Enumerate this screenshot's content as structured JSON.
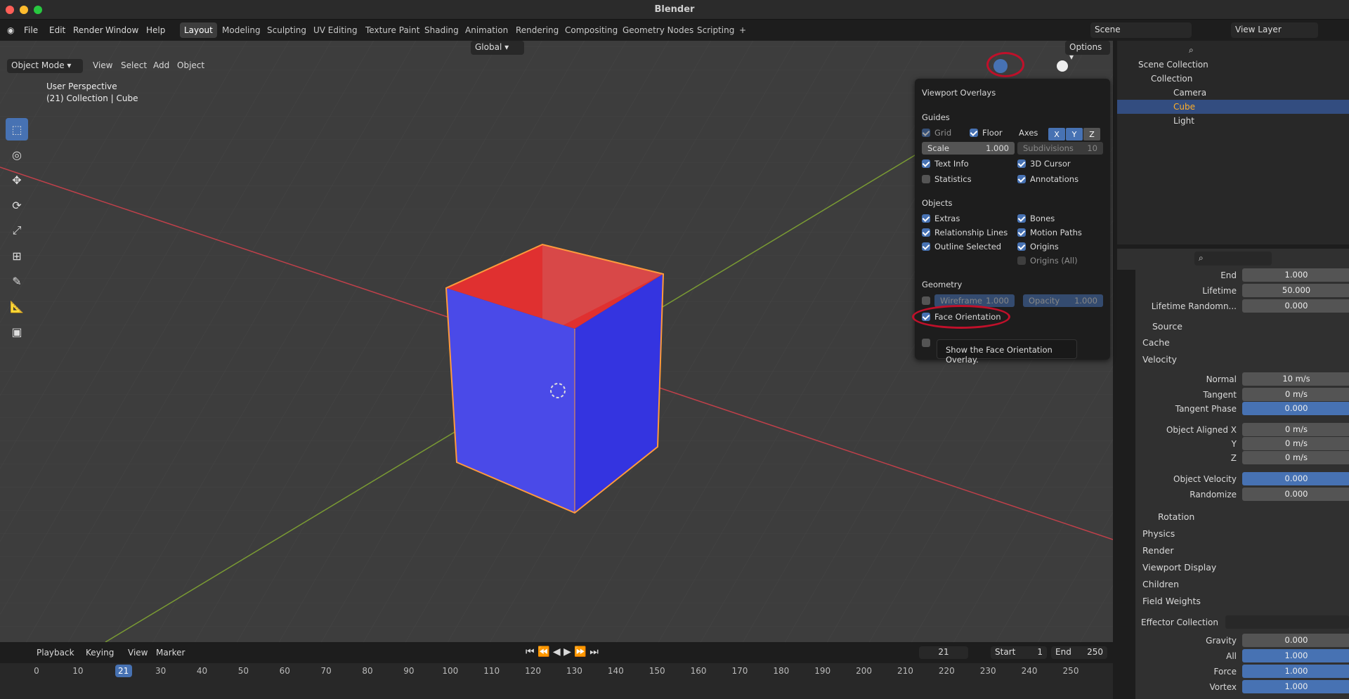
{
  "window": {
    "title": "Blender"
  },
  "menu": [
    "File",
    "Edit",
    "Render",
    "Window",
    "Help"
  ],
  "workspaces": [
    "Layout",
    "Modeling",
    "Sculpting",
    "UV Editing",
    "Texture Paint",
    "Shading",
    "Animation",
    "Rendering",
    "Compositing",
    "Geometry Nodes",
    "Scripting"
  ],
  "active_workspace": "Layout",
  "scene": {
    "scene_name": "Scene",
    "view_layer": "View Layer"
  },
  "viewport": {
    "mode": "Object Mode",
    "menus": [
      "View",
      "Select",
      "Add",
      "Object"
    ],
    "orientation": "Global",
    "options_label": "Options",
    "info_line1": "User Perspective",
    "info_line2": "(21) Collection | Cube"
  },
  "overlays": {
    "title": "Viewport Overlays",
    "guides": "Guides",
    "grid": "Grid",
    "floor": "Floor",
    "axes": "Axes",
    "axis_x": "X",
    "axis_y": "Y",
    "axis_z": "Z",
    "scale_label": "Scale",
    "scale_value": "1.000",
    "subdivisions_label": "Subdivisions",
    "subdivisions_value": "10",
    "text_info": "Text Info",
    "cursor_3d": "3D Cursor",
    "statistics": "Statistics",
    "annotations": "Annotations",
    "objects": "Objects",
    "extras": "Extras",
    "bones": "Bones",
    "relationship_lines": "Relationship Lines",
    "motion_paths": "Motion Paths",
    "outline_selected": "Outline Selected",
    "origins": "Origins",
    "origins_all": "Origins (All)",
    "geometry": "Geometry",
    "wireframe_label": "Wireframe",
    "wireframe_value": "1.000",
    "opacity_label": "Opacity",
    "opacity_value": "1.000",
    "face_orientation": "Face Orientation",
    "tooltip": "Show the Face Orientation Overlay."
  },
  "outliner": {
    "root": "Scene Collection",
    "collection": "Collection",
    "items": [
      "Camera",
      "Cube",
      "Light"
    ]
  },
  "properties": {
    "rows": [
      {
        "label": "End",
        "value": "1.000",
        "blue": false
      },
      {
        "label": "Lifetime",
        "value": "50.000",
        "blue": false
      },
      {
        "label": "Lifetime Randomn...",
        "value": "0.000",
        "blue": false
      }
    ],
    "source": "Source",
    "cache": "Cache",
    "velocity": "Velocity",
    "velocity_rows": [
      {
        "label": "Normal",
        "value": "10 m/s",
        "blue": false
      },
      {
        "label": "Tangent",
        "value": "0 m/s",
        "blue": false
      },
      {
        "label": "Tangent Phase",
        "value": "0.000",
        "blue": true
      }
    ],
    "aligned_rows": [
      {
        "label": "Object Aligned X",
        "value": "0 m/s"
      },
      {
        "label": "Y",
        "value": "0 m/s"
      },
      {
        "label": "Z",
        "value": "0 m/s"
      }
    ],
    "obj_rows": [
      {
        "label": "Object Velocity",
        "value": "0.000",
        "blue": true
      },
      {
        "label": "Randomize",
        "value": "0.000",
        "blue": false
      }
    ],
    "sections": [
      "Rotation",
      "Physics",
      "Render",
      "Viewport Display",
      "Children",
      "Field Weights"
    ],
    "effector_collection": "Effector Collection",
    "weights": [
      {
        "label": "Gravity",
        "value": "0.000",
        "blue": false
      },
      {
        "label": "All",
        "value": "1.000",
        "blue": true
      },
      {
        "label": "Force",
        "value": "1.000",
        "blue": true
      },
      {
        "label": "Vortex",
        "value": "1.000",
        "blue": true
      }
    ]
  },
  "timeline": {
    "menus": [
      "Playback",
      "Keying",
      "View",
      "Marker"
    ],
    "current_frame": "21",
    "start_label": "Start",
    "start": "1",
    "end_label": "End",
    "end": "250",
    "ticks": [
      "0",
      "10",
      "21",
      "30",
      "40",
      "50",
      "60",
      "70",
      "80",
      "90",
      "100",
      "110",
      "120",
      "130",
      "140",
      "150",
      "160",
      "170",
      "180",
      "190",
      "200",
      "210",
      "220",
      "230",
      "240",
      "250"
    ]
  },
  "colors": {
    "accent": "#4772b3",
    "highlight": "#c0102a",
    "front_face": "#3b3bff",
    "back_face": "#e02020"
  }
}
